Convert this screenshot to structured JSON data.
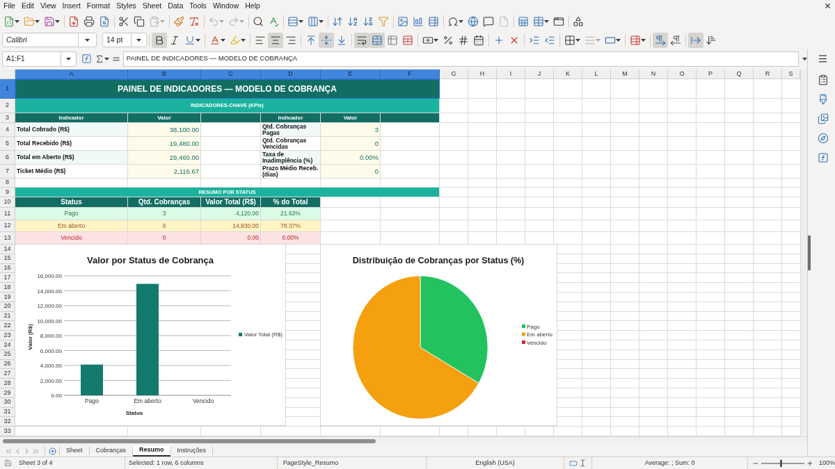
{
  "menu": [
    "File",
    "Edit",
    "View",
    "Insert",
    "Format",
    "Styles",
    "Sheet",
    "Data",
    "Tools",
    "Window",
    "Help"
  ],
  "standard_toolbar": [
    [
      {
        "kind": "new",
        "dropdown": true,
        "disabled": false
      },
      {
        "kind": "open",
        "dropdown": true,
        "disabled": false
      },
      {
        "kind": "save",
        "dropdown": true,
        "disabled": false
      }
    ],
    [
      {
        "kind": "pdf",
        "dropdown": false,
        "disabled": false
      },
      {
        "kind": "print",
        "dropdown": false,
        "disabled": false
      },
      {
        "kind": "preview",
        "dropdown": false,
        "disabled": false
      }
    ],
    [
      {
        "kind": "cut",
        "dropdown": false,
        "disabled": false
      },
      {
        "kind": "copy",
        "dropdown": false,
        "disabled": false
      },
      {
        "kind": "paste",
        "dropdown": true,
        "disabled": true
      }
    ],
    [
      {
        "kind": "clone",
        "dropdown": false,
        "disabled": false
      },
      {
        "kind": "clear",
        "dropdown": false,
        "disabled": false
      }
    ],
    [
      {
        "kind": "undo",
        "dropdown": true,
        "disabled": true
      },
      {
        "kind": "redo",
        "dropdown": true,
        "disabled": true
      }
    ],
    [
      {
        "kind": "find",
        "dropdown": false,
        "disabled": false
      },
      {
        "kind": "spelling",
        "dropdown": false,
        "disabled": false
      }
    ],
    [
      {
        "kind": "row",
        "dropdown": true,
        "disabled": false
      },
      {
        "kind": "column",
        "dropdown": true,
        "disabled": false
      }
    ],
    [
      {
        "kind": "sort",
        "dropdown": false,
        "disabled": false
      },
      {
        "kind": "ascending",
        "dropdown": false,
        "disabled": false
      },
      {
        "kind": "descending",
        "dropdown": false,
        "disabled": false
      },
      {
        "kind": "filter",
        "dropdown": false,
        "disabled": false
      }
    ],
    [
      {
        "kind": "image",
        "dropdown": false,
        "disabled": false
      },
      {
        "kind": "chart",
        "dropdown": false,
        "disabled": false
      },
      {
        "kind": "pivot",
        "dropdown": false,
        "disabled": false
      }
    ],
    [
      {
        "kind": "special",
        "dropdown": true,
        "disabled": false
      },
      {
        "kind": "hyperlink",
        "dropdown": false,
        "disabled": false
      },
      {
        "kind": "comment",
        "dropdown": false,
        "disabled": false
      },
      {
        "kind": "headerfooter",
        "dropdown": false,
        "disabled": true
      }
    ],
    [
      {
        "kind": "printarea",
        "dropdown": false,
        "disabled": false
      },
      {
        "kind": "freeze",
        "dropdown": true,
        "disabled": false
      },
      {
        "kind": "split",
        "dropdown": false,
        "disabled": false
      }
    ],
    [
      {
        "kind": "shapes",
        "dropdown": false,
        "disabled": false
      }
    ]
  ],
  "formatting_toolbar": {
    "font_name": {
      "value": "Calibri"
    },
    "font_size": {
      "value": "14 pt"
    },
    "groups": [
      [
        {
          "kind": "bold",
          "on": true,
          "dropdown": false,
          "disabled": false
        },
        {
          "kind": "italic",
          "on": false,
          "dropdown": false,
          "disabled": false
        },
        {
          "kind": "underline",
          "on": false,
          "dropdown": true,
          "disabled": false
        }
      ],
      [
        {
          "kind": "fontcolor",
          "on": false,
          "dropdown": true,
          "disabled": false
        },
        {
          "kind": "highlight",
          "on": false,
          "dropdown": true,
          "disabled": false
        }
      ],
      [
        {
          "kind": "left",
          "on": false,
          "dropdown": false,
          "disabled": false
        },
        {
          "kind": "center",
          "on": true,
          "dropdown": false,
          "disabled": false
        },
        {
          "kind": "right",
          "on": false,
          "dropdown": false,
          "disabled": false
        }
      ],
      [
        {
          "kind": "top",
          "on": false,
          "dropdown": false,
          "disabled": false
        },
        {
          "kind": "middle",
          "on": true,
          "dropdown": false,
          "disabled": false
        },
        {
          "kind": "bottom",
          "on": false,
          "dropdown": false,
          "disabled": false
        }
      ],
      [
        {
          "kind": "wrap",
          "on": true,
          "dropdown": false,
          "disabled": false
        },
        {
          "kind": "mergecenter",
          "on": true,
          "dropdown": false,
          "disabled": false
        },
        {
          "kind": "merge",
          "on": false,
          "dropdown": false,
          "disabled": false
        },
        {
          "kind": "unmerge",
          "on": false,
          "dropdown": false,
          "disabled": false
        }
      ],
      [
        {
          "kind": "currency",
          "on": false,
          "dropdown": true,
          "disabled": false
        },
        {
          "kind": "percent",
          "on": false,
          "dropdown": false,
          "disabled": false
        },
        {
          "kind": "number",
          "on": false,
          "dropdown": false,
          "disabled": false
        },
        {
          "kind": "date",
          "on": false,
          "dropdown": false,
          "disabled": false
        }
      ],
      [
        {
          "kind": "adddecimal",
          "on": false,
          "dropdown": false,
          "disabled": false
        },
        {
          "kind": "deletedecimal",
          "on": false,
          "dropdown": false,
          "disabled": false
        }
      ],
      [
        {
          "kind": "indent",
          "on": false,
          "dropdown": false,
          "disabled": false
        },
        {
          "kind": "outdent",
          "on": false,
          "dropdown": false,
          "disabled": false
        }
      ],
      [
        {
          "kind": "borders",
          "on": false,
          "dropdown": true,
          "disabled": false
        },
        {
          "kind": "borderstyle",
          "on": false,
          "dropdown": true,
          "disabled": true
        },
        {
          "kind": "bordercolor",
          "on": false,
          "dropdown": true,
          "disabled": false
        }
      ],
      [
        {
          "kind": "conditional",
          "on": false,
          "dropdown": true,
          "disabled": false
        }
      ],
      [
        {
          "kind": "ltr",
          "on": true,
          "dropdown": false,
          "disabled": false
        },
        {
          "kind": "rtl",
          "on": false,
          "dropdown": false,
          "disabled": false
        }
      ],
      [
        {
          "kind": "textdir",
          "on": true,
          "dropdown": false,
          "disabled": false
        },
        {
          "kind": "vertical",
          "on": false,
          "dropdown": false,
          "disabled": false
        }
      ]
    ]
  },
  "formula_bar": {
    "name_box": "A1:F1",
    "content": "PAINEL DE INDICADORES — MODELO DE COBRANÇA"
  },
  "sheet": {
    "columns": [
      {
        "label": "A",
        "selected": true
      },
      {
        "label": "B",
        "selected": true
      },
      {
        "label": "C",
        "selected": true
      },
      {
        "label": "D",
        "selected": true
      },
      {
        "label": "E",
        "selected": true
      },
      {
        "label": "F",
        "selected": true
      },
      {
        "label": "G",
        "selected": false
      },
      {
        "label": "H",
        "selected": false
      },
      {
        "label": "I",
        "selected": false
      },
      {
        "label": "J",
        "selected": false
      },
      {
        "label": "K",
        "selected": false
      },
      {
        "label": "L",
        "selected": false
      },
      {
        "label": "M",
        "selected": false
      },
      {
        "label": "N",
        "selected": false
      },
      {
        "label": "O",
        "selected": false
      },
      {
        "label": "P",
        "selected": false
      },
      {
        "label": "Q",
        "selected": false
      },
      {
        "label": "R",
        "selected": false
      },
      {
        "label": "S",
        "selected": false
      }
    ],
    "rows": [
      {
        "label": "1",
        "selected": true,
        "cells": [
          {
            "kind": "title",
            "text": "PAINEL DE INDICADORES — MODELO DE COBRANÇA"
          }
        ]
      },
      {
        "label": "2",
        "selected": false,
        "cells": [
          {
            "kind": "section",
            "text": "INDICADORES-CHAVE (KPIs)"
          }
        ]
      },
      {
        "label": "3",
        "selected": false,
        "cells": [
          {
            "kind": "kpi_header",
            "text": "Indicador"
          },
          {
            "kind": "kpi_header",
            "text": "Valor"
          },
          {
            "kind": "kpi_header"
          },
          {
            "kind": "kpi_header",
            "text": "Indicador"
          },
          {
            "kind": "kpi_header",
            "text": "Valor"
          },
          {
            "kind": "kpi_header"
          }
        ]
      },
      {
        "label": "4",
        "selected": false,
        "cells": [
          {
            "kind": "label_alt",
            "text": "Total Cobrado (R$)"
          },
          {
            "kind": "value",
            "text": "38,100.00"
          },
          {
            "kind": "blank"
          },
          {
            "kind": "label_alt",
            "text": "Qtd. Cobranças Pagas"
          },
          {
            "kind": "value",
            "text": "3"
          }
        ]
      },
      {
        "label": "5",
        "selected": false,
        "cells": [
          {
            "kind": "label",
            "text": "Total Recebido (R$)"
          },
          {
            "kind": "value",
            "text": "19,480.00"
          },
          {
            "kind": "blank"
          },
          {
            "kind": "label",
            "text": "Qtd. Cobranças Vencidas"
          },
          {
            "kind": "value",
            "text": "0"
          }
        ]
      },
      {
        "label": "6",
        "selected": false,
        "cells": [
          {
            "kind": "label_alt",
            "text": "Total em Aberto (R$)"
          },
          {
            "kind": "value",
            "text": "29,460.00"
          },
          {
            "kind": "blank"
          },
          {
            "kind": "label_alt",
            "text": "Taxa de Inadimplência (%)"
          },
          {
            "kind": "value",
            "text": "0.00%"
          }
        ]
      },
      {
        "label": "7",
        "selected": false,
        "cells": [
          {
            "kind": "label",
            "text": "Ticket Médio (R$)"
          },
          {
            "kind": "value",
            "text": "2,116.67"
          },
          {
            "kind": "blank"
          },
          {
            "kind": "label",
            "text": "Prazo Médio Receb. (dias)"
          },
          {
            "kind": "value",
            "text": "0"
          }
        ]
      },
      {
        "label": "8",
        "selected": false
      },
      {
        "label": "9",
        "selected": false,
        "cells": [
          {
            "kind": "section",
            "text": "RESUMO POR STATUS"
          }
        ]
      },
      {
        "label": "10",
        "selected": false,
        "cells": [
          {
            "kind": "table_header",
            "text": "Status"
          },
          {
            "kind": "table_header",
            "text": "Qtd. Cobranças"
          },
          {
            "kind": "table_header",
            "text": "Valor Total (R$)"
          },
          {
            "kind": "table_header",
            "text": "% do Total"
          }
        ]
      },
      {
        "label": "11",
        "selected": false,
        "cells": [
          {
            "kind": "paid",
            "text": "Pago"
          },
          {
            "kind": "paid",
            "text": "3"
          },
          {
            "kind": "paid",
            "text": "4,120.00"
          },
          {
            "kind": "paid",
            "text": "21.63%"
          }
        ]
      },
      {
        "label": "12",
        "selected": false,
        "cells": [
          {
            "kind": "open",
            "text": "Em aberto"
          },
          {
            "kind": "open",
            "text": "6"
          },
          {
            "kind": "open",
            "text": "14,930.00"
          },
          {
            "kind": "open",
            "text": "78.37%"
          }
        ]
      },
      {
        "label": "13",
        "selected": false,
        "cells": [
          {
            "kind": "overdue",
            "text": "Vencido"
          },
          {
            "kind": "overdue",
            "text": "0"
          },
          {
            "kind": "overdue",
            "text": "0.00"
          },
          {
            "kind": "overdue",
            "text": "0.00%"
          }
        ]
      },
      {
        "label": "14",
        "selected": false
      },
      {
        "label": "15",
        "selected": false
      },
      {
        "label": "16",
        "selected": false
      },
      {
        "label": "17",
        "selected": false
      },
      {
        "label": "18",
        "selected": false
      },
      {
        "label": "19",
        "selected": false
      },
      {
        "label": "20",
        "selected": false
      },
      {
        "label": "21",
        "selected": false
      },
      {
        "label": "22",
        "selected": false
      },
      {
        "label": "23",
        "selected": false
      },
      {
        "label": "24",
        "selected": false
      },
      {
        "label": "25",
        "selected": false
      },
      {
        "label": "26",
        "selected": false
      },
      {
        "label": "27",
        "selected": false
      },
      {
        "label": "28",
        "selected": false
      },
      {
        "label": "29",
        "selected": false
      },
      {
        "label": "30",
        "selected": false
      },
      {
        "label": "31",
        "selected": false
      },
      {
        "label": "32",
        "selected": false
      },
      {
        "label": "33",
        "selected": false
      }
    ],
    "charts": [
      {
        "chart_data": {
          "type": "bar",
          "title": "Valor por Status de Cobrança",
          "xlabel": "Status",
          "ylabel": "Valor (R$)",
          "categories": [
            "Pago",
            "Em aberto",
            "Vencido"
          ],
          "series": [
            {
              "name": "Valor Total (R$)",
              "color": "#137a6e",
              "values": [
                4120,
                14930,
                0
              ]
            }
          ],
          "ylim": [
            0,
            16000
          ],
          "yticks": [
            {
              "value": 0,
              "label": "0.00"
            },
            {
              "value": 2000,
              "label": "2,000.00"
            },
            {
              "value": 4000,
              "label": "4,000.00"
            },
            {
              "value": 6000,
              "label": "6,000.00"
            },
            {
              "value": 8000,
              "label": "8,000.00"
            },
            {
              "value": 10000,
              "label": "10,000.00"
            },
            {
              "value": 12000,
              "label": "12,000.00"
            },
            {
              "value": 14000,
              "label": "14,000.00"
            },
            {
              "value": 16000,
              "label": "16,000.00"
            }
          ],
          "grid": true,
          "legend": true
        }
      },
      {
        "chart_data": {
          "type": "pie",
          "title": "Distribuição de Cobranças por Status (%)",
          "categories": [
            "Pago",
            "Em aberto",
            "Vencido"
          ],
          "values": [
            33.33,
            66.67,
            0
          ],
          "colors": [
            "#22c35e",
            "#f4a00f",
            "#d42a2a"
          ],
          "legend": true
        }
      }
    ]
  },
  "sheet_tabs": [
    {
      "label": "Sheet",
      "selected": false
    },
    {
      "label": "Cobranças",
      "selected": false
    },
    {
      "label": "Resumo",
      "selected": true
    },
    {
      "label": "Instruções",
      "selected": false
    }
  ],
  "status_bar": {
    "sheet": "Sheet 3 of 4",
    "selection": "Selected: 1 row, 6 columns",
    "page_style": "PageStyle_Resumo",
    "language": "English (USA)",
    "statistics": "Average: ; Sum: 0",
    "zoom": {
      "level": 0.46,
      "reading": "100%"
    }
  }
}
